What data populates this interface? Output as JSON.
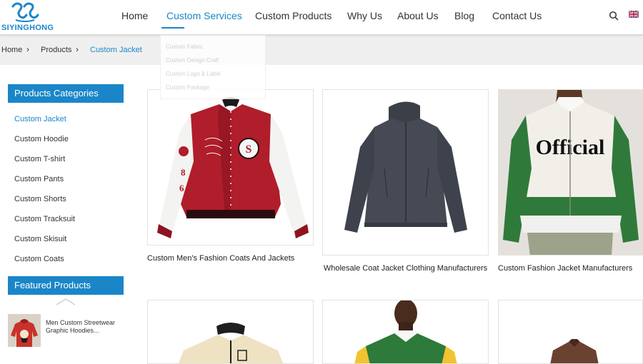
{
  "brand": {
    "name": "SIYINGHONG",
    "color": "#1a86c8"
  },
  "nav": {
    "items": [
      "Home",
      "Custom Services",
      "Custom Products",
      "Why Us",
      "About Us",
      "Blog",
      "Contact Us"
    ],
    "active": "Custom Services",
    "icons": [
      "search-icon",
      "uk-flag-icon"
    ]
  },
  "dropdown": {
    "items": [
      "Custom Fabric",
      "Custom Design Craft",
      "Custom Logo & Label",
      "Custom Package"
    ]
  },
  "breadcrumb": [
    "Home",
    "Products",
    "Custom Jacket"
  ],
  "sidebar": {
    "categories_title": "Products Categories",
    "categories": [
      "Custom Jacket",
      "Custom Hoodie",
      "Custom T-shirt",
      "Custom Pants",
      "Custom Shorts",
      "Custom Tracksuit",
      "Custom Skisuit",
      "Custom Coats"
    ],
    "active_category": "Custom Jacket",
    "featured_title": "Featured Products",
    "featured": [
      {
        "title": "Men Custom Streetwear Graphic Hoodies..."
      }
    ]
  },
  "products": [
    {
      "title": "Custom Men's Fashion Coats And Jackets"
    },
    {
      "title": "Wholesale Coat Jacket Clothing Manufacturers"
    },
    {
      "title": "Custom Fashion Jacket Manufacturers"
    }
  ]
}
